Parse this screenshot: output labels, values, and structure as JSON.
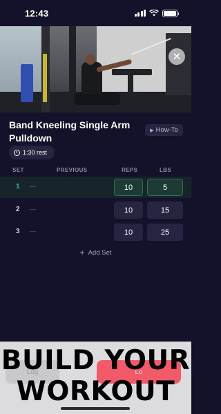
{
  "status_bar": {
    "time": "12:43"
  },
  "video": {
    "close_icon": "close-icon"
  },
  "exercise": {
    "title": "Band Kneeling Single Arm Pulldown",
    "howto_label": "How-To",
    "rest_label": "1:30 rest"
  },
  "table": {
    "headers": {
      "set": "SET",
      "previous": "PREVIOUS",
      "reps": "REPS",
      "lbs": "LBS"
    },
    "rows": [
      {
        "set": "1",
        "previous": "—",
        "reps": "10",
        "lbs": "5",
        "active": true
      },
      {
        "set": "2",
        "previous": "—",
        "reps": "10",
        "lbs": "15",
        "active": false
      },
      {
        "set": "3",
        "previous": "—",
        "reps": "10",
        "lbs": "25",
        "active": false
      }
    ],
    "add_set_label": "Add Set"
  },
  "footer": {
    "log_label": "Log",
    "done_label": "Lo"
  },
  "overlay": {
    "line1": "BUILD YOUR",
    "line2": "WORKOUT"
  },
  "colors": {
    "background": "#14122a",
    "accent_green": "#34c08c",
    "accent_red": "#f25a6a",
    "cell": "#262440"
  }
}
